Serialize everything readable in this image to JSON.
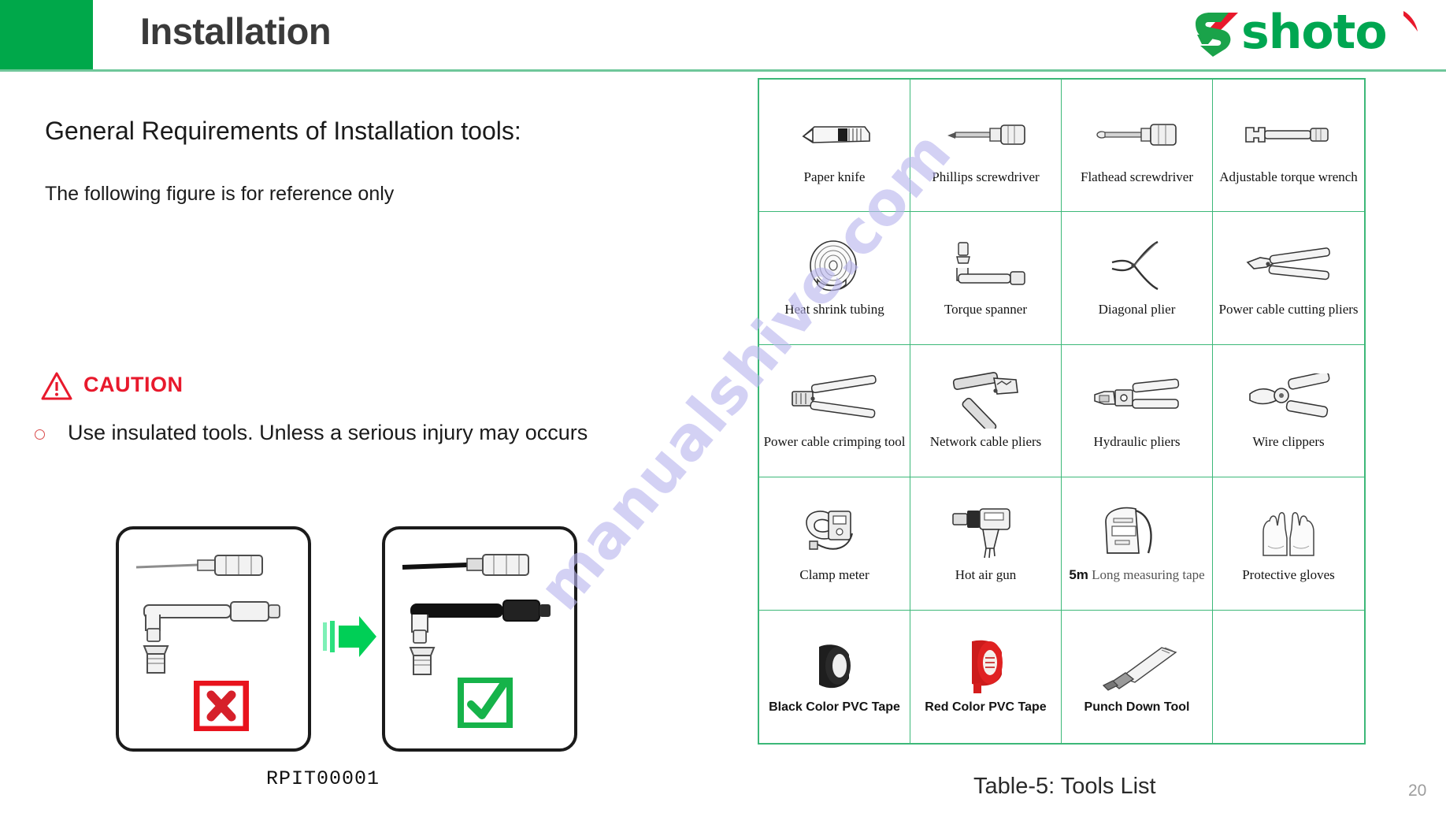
{
  "header": {
    "title": "Installation",
    "logo_word": "shoto",
    "logo_mark_name": "shoto-s-bolt-logo",
    "accent_green": "#00a84a",
    "logo_green": "#00a651",
    "logo_red": "#e8192c"
  },
  "left": {
    "lead_title": "General Requirements of Installation tools:",
    "lead_sub": "The following figure is for reference only",
    "caution": {
      "label": "CAUTION",
      "color": "#e8192c",
      "bullet": "Use insulated tools. Unless a serious injury may occurs"
    },
    "figure": {
      "bad_badge": "cross-mark",
      "good_badge": "check-mark",
      "arrow": "green-right-arrow",
      "bad_tools": "uninsulated screwdriver and torque wrench",
      "good_tools": "insulated screwdriver and torque wrench"
    },
    "doc_code": "RPIT00001"
  },
  "table": {
    "caption": "Table-5: Tools List",
    "border_color": "#3cb878",
    "columns": 4,
    "rows": 5,
    "cells": [
      {
        "label": "Paper knife",
        "icon": "paper-knife-icon",
        "bold": false
      },
      {
        "label": "Phillips screwdriver",
        "icon": "phillips-screwdriver-icon",
        "bold": false
      },
      {
        "label": "Flathead screwdriver",
        "icon": "flathead-screwdriver-icon",
        "bold": false
      },
      {
        "label": "Adjustable torque wrench",
        "icon": "adjustable-torque-wrench-icon",
        "bold": false
      },
      {
        "label": "Heat shrink tubing",
        "icon": "heat-shrink-tubing-icon",
        "bold": false
      },
      {
        "label": "Torque spanner",
        "icon": "torque-spanner-icon",
        "bold": false
      },
      {
        "label": "Diagonal plier",
        "icon": "diagonal-plier-icon",
        "bold": false
      },
      {
        "label": "Power cable cutting pliers",
        "icon": "power-cable-cutting-pliers-icon",
        "bold": false
      },
      {
        "label": "Power cable crimping tool",
        "icon": "power-cable-crimping-tool-icon",
        "bold": false
      },
      {
        "label": "Network cable pliers",
        "icon": "network-cable-pliers-icon",
        "bold": false
      },
      {
        "label": "Hydraulic pliers",
        "icon": "hydraulic-pliers-icon",
        "bold": false
      },
      {
        "label": "Wire clippers",
        "icon": "wire-clippers-icon",
        "bold": false
      },
      {
        "label": "Clamp meter",
        "icon": "clamp-meter-icon",
        "bold": false
      },
      {
        "label": "Hot air gun",
        "icon": "hot-air-gun-icon",
        "bold": false
      },
      {
        "label": "5m Long measuring tape",
        "lead": "5m",
        "rest": " Long measuring tape",
        "icon": "measuring-tape-icon",
        "bold": false
      },
      {
        "label": "Protective gloves",
        "icon": "protective-gloves-icon",
        "bold": false
      },
      {
        "label": "Black Color PVC Tape",
        "icon": "black-pvc-tape-icon",
        "bold": true
      },
      {
        "label": "Red Color PVC Tape",
        "icon": "red-pvc-tape-icon",
        "bold": true
      },
      {
        "label": "Punch Down Tool",
        "icon": "punch-down-tool-icon",
        "bold": true
      },
      {
        "label": "",
        "icon": "",
        "bold": false
      }
    ]
  },
  "footer": {
    "page_number": "20"
  },
  "watermark": {
    "text": "manualshive.com",
    "color": "#b9b5ee"
  }
}
